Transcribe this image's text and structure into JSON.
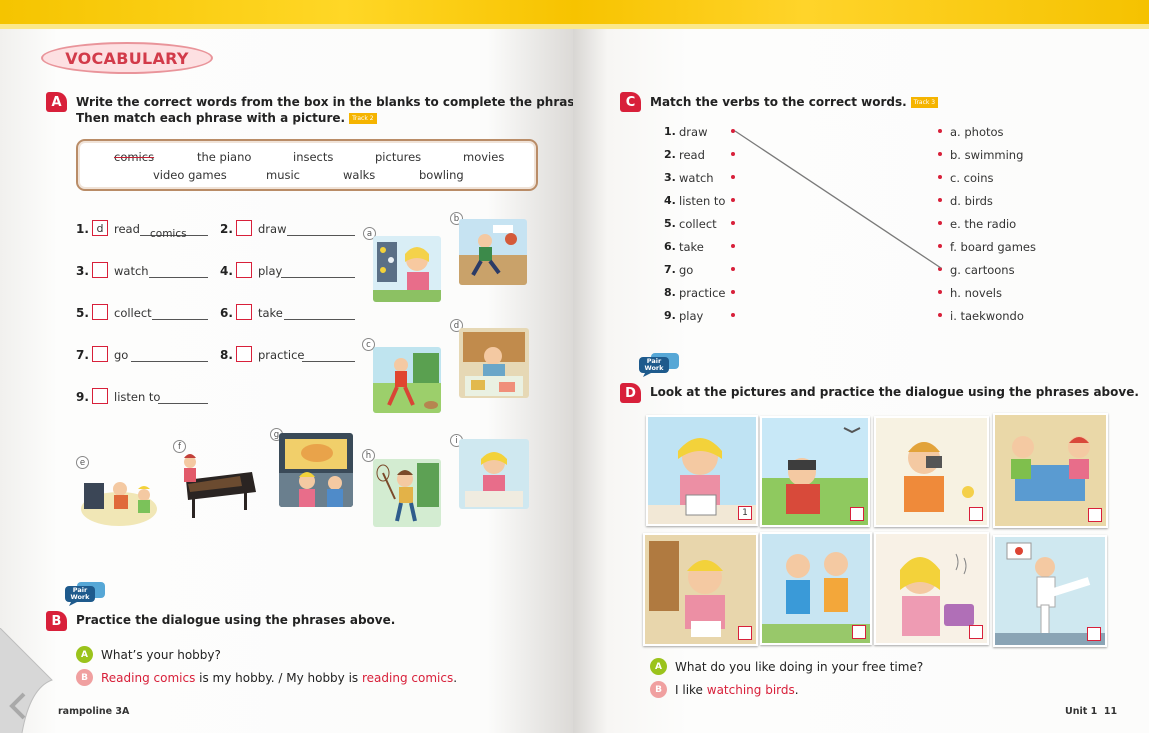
{
  "left_page": {
    "section_title": "VOCABULARY",
    "section_a": {
      "letter": "A",
      "instruction_line1": "Write the correct words from the box in the blanks to complete the phrases.",
      "instruction_line2": "Then match each phrase with a picture.",
      "track": "Track 2",
      "word_box": [
        "comics",
        "the piano",
        "insects",
        "pictures",
        "movies",
        "video games",
        "music",
        "walks",
        "bowling"
      ],
      "items": [
        {
          "num": "1.",
          "box": "d",
          "verb": "read",
          "answer": "comics"
        },
        {
          "num": "2.",
          "box": "",
          "verb": "draw",
          "answer": ""
        },
        {
          "num": "3.",
          "box": "",
          "verb": "watch",
          "answer": ""
        },
        {
          "num": "4.",
          "box": "",
          "verb": "play",
          "answer": ""
        },
        {
          "num": "5.",
          "box": "",
          "verb": "collect",
          "answer": ""
        },
        {
          "num": "6.",
          "box": "",
          "verb": "take",
          "answer": ""
        },
        {
          "num": "7.",
          "box": "",
          "verb": "go",
          "answer": ""
        },
        {
          "num": "8.",
          "box": "",
          "verb": "practice",
          "answer": ""
        },
        {
          "num": "9.",
          "box": "",
          "verb": "listen to",
          "answer": ""
        }
      ],
      "picture_labels": [
        "a",
        "b",
        "c",
        "d",
        "e",
        "f",
        "g",
        "h",
        "i"
      ]
    },
    "section_b": {
      "letter": "B",
      "pair_work": "Pair Work",
      "instruction": "Practice the dialogue using the phrases above.",
      "speaker_a": "A",
      "speaker_b": "B",
      "line_a": "What’s your hobby?",
      "line_b_part1": "Reading comics",
      "line_b_part2": " is my hobby. / My hobby is ",
      "line_b_part3": "reading comics",
      "line_b_part4": "."
    },
    "footer": "rampoline 3A"
  },
  "right_page": {
    "section_c": {
      "letter": "C",
      "instruction": "Match the verbs to the correct words.",
      "track": "Track 3",
      "verbs": [
        {
          "num": "1.",
          "text": "draw"
        },
        {
          "num": "2.",
          "text": "read"
        },
        {
          "num": "3.",
          "text": "watch"
        },
        {
          "num": "4.",
          "text": "listen to"
        },
        {
          "num": "5.",
          "text": "collect"
        },
        {
          "num": "6.",
          "text": "take"
        },
        {
          "num": "7.",
          "text": "go"
        },
        {
          "num": "8.",
          "text": "practice"
        },
        {
          "num": "9.",
          "text": "play"
        }
      ],
      "words": [
        "a. photos",
        "b. swimming",
        "c. coins",
        "d. birds",
        "e. the radio",
        "f. board games",
        "g. cartoons",
        "h. novels",
        "i. taekwondo"
      ]
    },
    "section_d": {
      "letter": "D",
      "pair_work": "Pair Work",
      "instruction": "Look at the pictures and practice the dialogue using the phrases above.",
      "first_box": "1",
      "speaker_a": "A",
      "speaker_b": "B",
      "line_a": "What do you like doing in your free time?",
      "line_b_part1": "I like ",
      "line_b_part2": "watching birds",
      "line_b_part3": "."
    },
    "footer_unit": "Unit 1",
    "footer_page": "11"
  },
  "colors": {
    "accent_red": "#d8203a",
    "banner_yellow": "#f5c400",
    "speaker_a": "#9bc31c",
    "speaker_b": "#f0a0a0"
  }
}
